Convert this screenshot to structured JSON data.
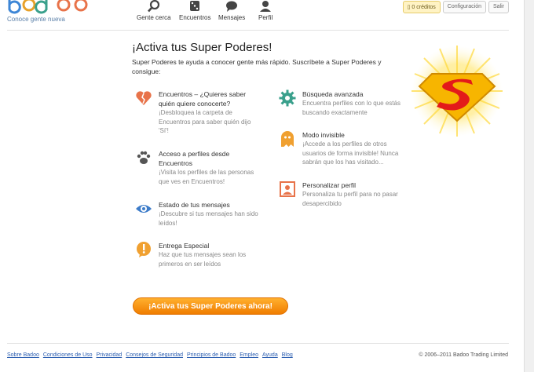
{
  "header": {
    "logo_text": "Badoo",
    "tagline": "Conoce gente nueva",
    "nav": [
      {
        "label": "Gente cerca",
        "icon": "search-icon"
      },
      {
        "label": "Encuentros",
        "icon": "dice-icon"
      },
      {
        "label": "Mensajes",
        "icon": "chat-icon"
      },
      {
        "label": "Perfil",
        "icon": "user-icon"
      }
    ],
    "credits_label": "0 créditos",
    "settings_label": "Configuración",
    "logout_label": "Salir"
  },
  "main": {
    "title": "¡Activa tus Super Poderes!",
    "subtitle": "Super Poderes te ayuda a conocer gente más rápido. Suscríbete a Super Poderes y consigue:",
    "features": [
      {
        "title": "Encuentros – ¿Quieres saber quién quiere conocerte?",
        "desc": "¡Desbloquea la carpeta de Encuentros para saber quién dijo 'Sí'!",
        "icon": "broken-heart-icon",
        "color": "#e8734a"
      },
      {
        "title": "Acceso a perfiles desde Encuentros",
        "desc": "¡Visita los perfiles de las personas que ves en Encuentros!",
        "icon": "paw-icon",
        "color": "#555555"
      },
      {
        "title": "Estado de tus mensajes",
        "desc": "¡Descubre si tus mensajes han sido leídos!",
        "icon": "eye-icon",
        "color": "#3d7cc9"
      },
      {
        "title": "Entrega Especial",
        "desc": "Haz que tus mensajes sean los primeros en ser leídos",
        "icon": "alert-bubble-icon",
        "color": "#f0a030"
      },
      {
        "title": "Búsqueda avanzada",
        "desc": "Encuentra perfiles con lo que estás buscando exactamente",
        "icon": "gear-icon",
        "color": "#3aa08c"
      },
      {
        "title": "Modo invisible",
        "desc": "¡Accede a los perfiles de otros usuarios de forma invisible! Nunca sabrán que los has visitado...",
        "icon": "ghost-icon",
        "color": "#f0a030"
      },
      {
        "title": "Personalizar perfil",
        "desc": "Personaliza tu perfil para no pasar desapercibido",
        "icon": "profile-frame-icon",
        "color": "#e8734a"
      }
    ],
    "cta_label": "¡Activa tus Super Poderes ahora!",
    "emblem_icon": "superpower-emblem-icon"
  },
  "footer": {
    "links": [
      "Sobre Badoo",
      "Condiciones de Uso",
      "Privacidad",
      "Consejos de Seguridad",
      "Principios de Badoo",
      "Empleo",
      "Ayuda",
      "Blog"
    ],
    "copyright": "© 2006–2011 Badoo Trading Limited"
  }
}
